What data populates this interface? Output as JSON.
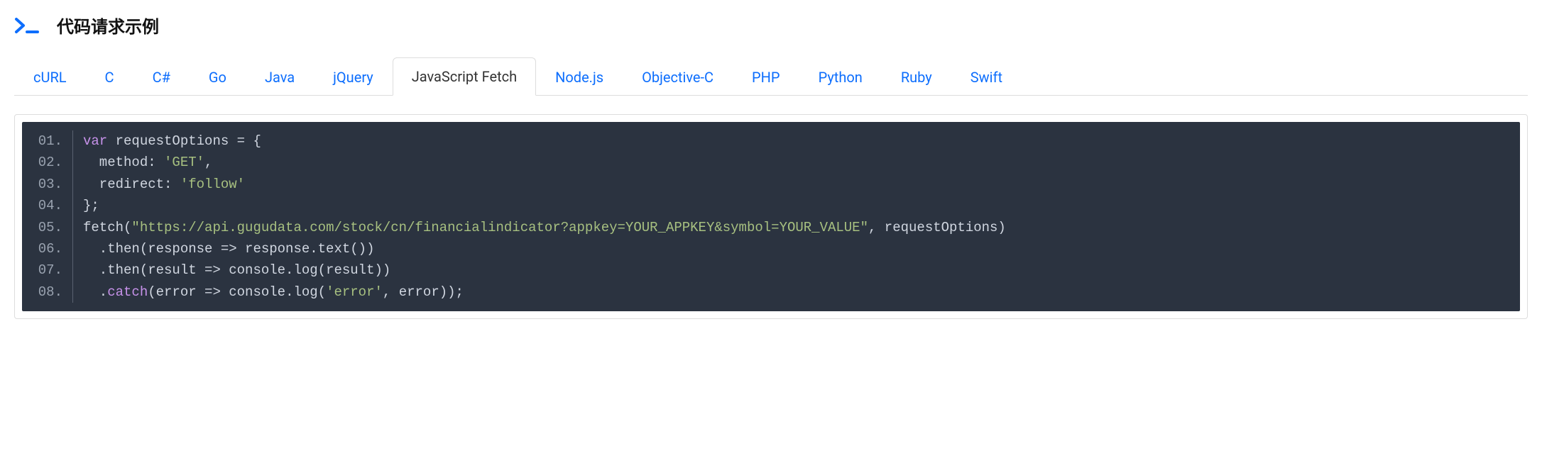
{
  "header": {
    "title": "代码请求示例",
    "icon": "terminal-icon"
  },
  "tabs": {
    "items": [
      {
        "label": "cURL",
        "active": false
      },
      {
        "label": "C",
        "active": false
      },
      {
        "label": "C#",
        "active": false
      },
      {
        "label": "Go",
        "active": false
      },
      {
        "label": "Java",
        "active": false
      },
      {
        "label": "jQuery",
        "active": false
      },
      {
        "label": "JavaScript Fetch",
        "active": true
      },
      {
        "label": "Node.js",
        "active": false
      },
      {
        "label": "Objective-C",
        "active": false
      },
      {
        "label": "PHP",
        "active": false
      },
      {
        "label": "Python",
        "active": false
      },
      {
        "label": "Ruby",
        "active": false
      },
      {
        "label": "Swift",
        "active": false
      }
    ]
  },
  "code": {
    "lines": [
      {
        "num": "01.",
        "tokens": [
          {
            "t": "var",
            "c": "keyword"
          },
          {
            "t": " requestOptions = {",
            "c": "plain"
          }
        ]
      },
      {
        "num": "02.",
        "tokens": [
          {
            "t": "  method: ",
            "c": "plain"
          },
          {
            "t": "'GET'",
            "c": "string"
          },
          {
            "t": ",",
            "c": "plain"
          }
        ]
      },
      {
        "num": "03.",
        "tokens": [
          {
            "t": "  redirect: ",
            "c": "plain"
          },
          {
            "t": "'follow'",
            "c": "string"
          }
        ]
      },
      {
        "num": "04.",
        "tokens": [
          {
            "t": "};",
            "c": "plain"
          }
        ]
      },
      {
        "num": "05.",
        "tokens": [
          {
            "t": "fetch(",
            "c": "plain"
          },
          {
            "t": "\"https://api.gugudata.com/stock/cn/financialindicator?appkey=YOUR_APPKEY&symbol=YOUR_VALUE\"",
            "c": "string"
          },
          {
            "t": ", requestOptions)",
            "c": "plain"
          }
        ]
      },
      {
        "num": "06.",
        "tokens": [
          {
            "t": "  .then(response => response.text())",
            "c": "plain"
          }
        ]
      },
      {
        "num": "07.",
        "tokens": [
          {
            "t": "  .then(result => console.log(result))",
            "c": "plain"
          }
        ]
      },
      {
        "num": "08.",
        "tokens": [
          {
            "t": "  .",
            "c": "plain"
          },
          {
            "t": "catch",
            "c": "keyword"
          },
          {
            "t": "(error => console.log(",
            "c": "plain"
          },
          {
            "t": "'error'",
            "c": "string"
          },
          {
            "t": ", error));",
            "c": "plain"
          }
        ]
      }
    ]
  }
}
